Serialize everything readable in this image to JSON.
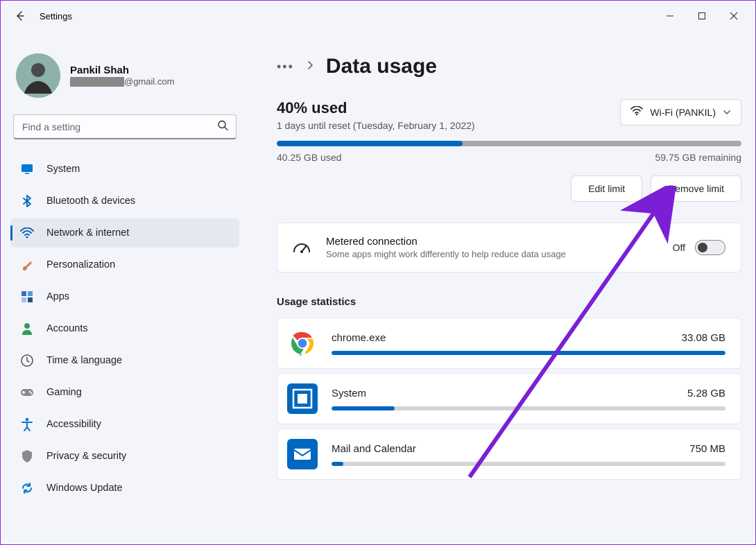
{
  "window": {
    "app_title": "Settings"
  },
  "profile": {
    "name": "Pankil Shah",
    "email_suffix": "@gmail.com"
  },
  "search": {
    "placeholder": "Find a setting"
  },
  "nav": [
    {
      "key": "system",
      "label": "System",
      "icon": "monitor",
      "color": "#0078d4"
    },
    {
      "key": "bluetooth",
      "label": "Bluetooth & devices",
      "icon": "bluetooth",
      "color": "#0067c0"
    },
    {
      "key": "network",
      "label": "Network & internet",
      "icon": "wifi",
      "color": "#0067c0",
      "active": true
    },
    {
      "key": "personalization",
      "label": "Personalization",
      "icon": "brush",
      "color": "#d87a4a"
    },
    {
      "key": "apps",
      "label": "Apps",
      "icon": "apps",
      "color": "#3b6fb6"
    },
    {
      "key": "accounts",
      "label": "Accounts",
      "icon": "person",
      "color": "#2e9c5b"
    },
    {
      "key": "time",
      "label": "Time & language",
      "icon": "clock",
      "color": "#5a5a5a"
    },
    {
      "key": "gaming",
      "label": "Gaming",
      "icon": "gamepad",
      "color": "#8a8a8a"
    },
    {
      "key": "accessibility",
      "label": "Accessibility",
      "icon": "accessibility",
      "color": "#0078d4"
    },
    {
      "key": "privacy",
      "label": "Privacy & security",
      "icon": "shield",
      "color": "#8a8a8a"
    },
    {
      "key": "update",
      "label": "Windows Update",
      "icon": "update",
      "color": "#0078d4"
    }
  ],
  "breadcrumb": {
    "page_title": "Data usage"
  },
  "usage": {
    "percent_label": "40% used",
    "reset_label": "1 days until reset (Tuesday, February 1, 2022)",
    "network_name": "Wi-Fi (PANKIL)",
    "used_label": "40.25 GB used",
    "remaining_label": "59.75 GB remaining",
    "progress_percent": 40,
    "edit_button": "Edit limit",
    "remove_button": "Remove limit"
  },
  "metered": {
    "title": "Metered connection",
    "desc": "Some apps might work differently to help reduce data usage",
    "state_label": "Off"
  },
  "stats": {
    "section_title": "Usage statistics",
    "items": [
      {
        "name": "chrome.exe",
        "size": "33.08 GB",
        "fill": 100,
        "icon": "chrome"
      },
      {
        "name": "System",
        "size": "5.28 GB",
        "fill": 16,
        "icon": "system-app"
      },
      {
        "name": "Mail and Calendar",
        "size": "750 MB",
        "fill": 3,
        "icon": "mail"
      }
    ]
  },
  "chart_data": {
    "type": "bar",
    "title": "Data usage",
    "categories": [
      "Used",
      "Remaining"
    ],
    "values": [
      40.25,
      59.75
    ],
    "unit": "GB",
    "total": 100,
    "series": [
      {
        "name": "Usage statistics (GB)",
        "categories": [
          "chrome.exe",
          "System",
          "Mail and Calendar"
        ],
        "values": [
          33.08,
          5.28,
          0.75
        ]
      }
    ]
  }
}
